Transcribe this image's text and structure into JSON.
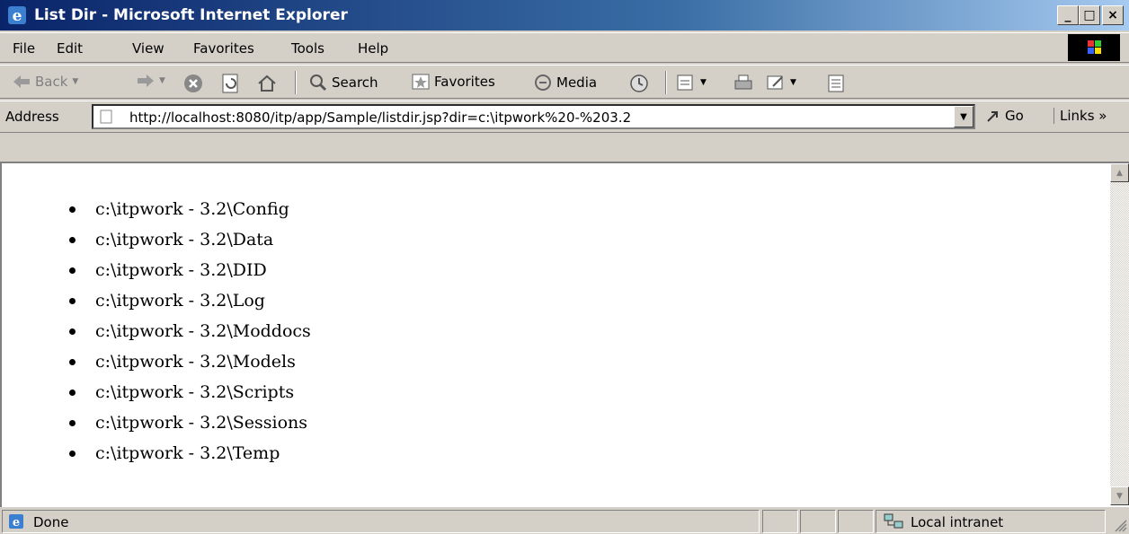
{
  "window": {
    "title": "List Dir - Microsoft Internet Explorer",
    "controls": {
      "minimize": "_",
      "maximize": "□",
      "close": "×"
    }
  },
  "menu": {
    "items": [
      {
        "label": "File"
      },
      {
        "label": "Edit"
      },
      {
        "label": "View"
      },
      {
        "label": "Favorites"
      },
      {
        "label": "Tools"
      },
      {
        "label": "Help"
      }
    ]
  },
  "toolbar": {
    "back_label": "Back",
    "search_label": "Search",
    "favorites_label": "Favorites",
    "media_label": "Media"
  },
  "address": {
    "label": "Address",
    "url": "http://localhost:8080/itp/app/Sample/listdir.jsp?dir=c:\\itpwork%20-%203.2",
    "go_label": "Go",
    "links_label": "Links »"
  },
  "page": {
    "items": [
      "c:\\itpwork - 3.2\\Config",
      "c:\\itpwork - 3.2\\Data",
      "c:\\itpwork - 3.2\\DID",
      "c:\\itpwork - 3.2\\Log",
      "c:\\itpwork - 3.2\\Moddocs",
      "c:\\itpwork - 3.2\\Models",
      "c:\\itpwork - 3.2\\Scripts",
      "c:\\itpwork - 3.2\\Sessions",
      "c:\\itpwork - 3.2\\Temp"
    ]
  },
  "status": {
    "text": "Done",
    "zone": "Local intranet"
  },
  "colors": {
    "titlebar_start": "#0a246a",
    "titlebar_end": "#a6caf0",
    "chrome": "#d4d0c8"
  }
}
